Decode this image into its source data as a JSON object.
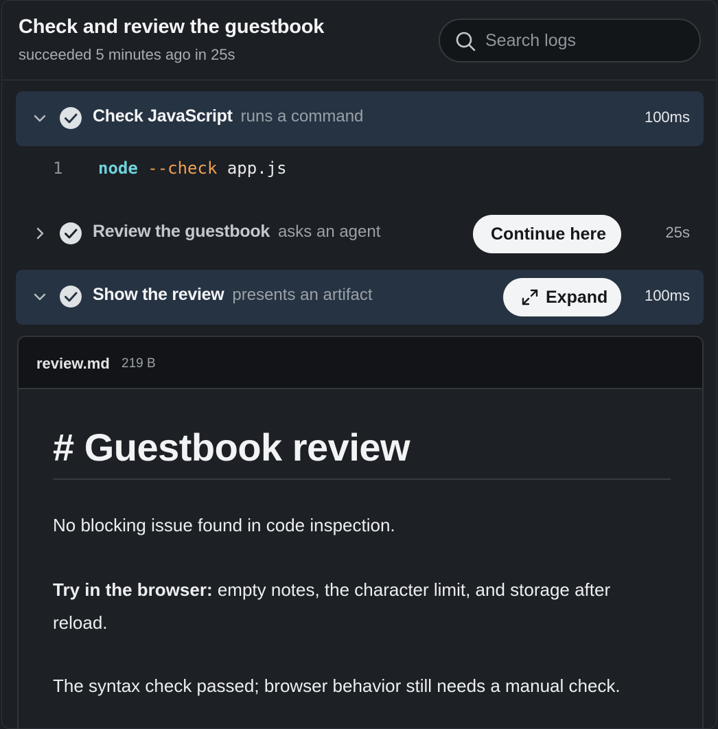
{
  "header": {
    "title": "Check and review the guestbook",
    "subtitle": "succeeded 5 minutes ago in 25s",
    "search_placeholder": "Search logs"
  },
  "steps": [
    {
      "name": "Check JavaScript",
      "kind": "runs a command",
      "duration": "100ms",
      "state": "expanded"
    },
    {
      "name": "Review the guestbook",
      "kind": "asks an agent",
      "duration": "25s",
      "state": "collapsed",
      "action": "Continue here"
    },
    {
      "name": "Show the review",
      "kind": "presents an artifact",
      "duration": "100ms",
      "state": "expanded",
      "action": "Expand"
    }
  ],
  "code": {
    "line_number": "1",
    "command": "node",
    "flag": "--check",
    "arg": "app.js"
  },
  "artifact": {
    "filename": "review.md",
    "size": "219 B",
    "heading": "# Guestbook review",
    "p1": "No blocking issue found in code inspection.",
    "p2_bold": "Try in the browser:",
    "p2_rest": " empty notes, the character limit, and storage after reload.",
    "p3": "The syntax check passed; browser behavior still needs a manual check."
  },
  "colors": {
    "background": "#1c1f23",
    "step_highlight": "#263343",
    "command_token": "#6fd3dd",
    "flag_token": "#f0a050"
  }
}
